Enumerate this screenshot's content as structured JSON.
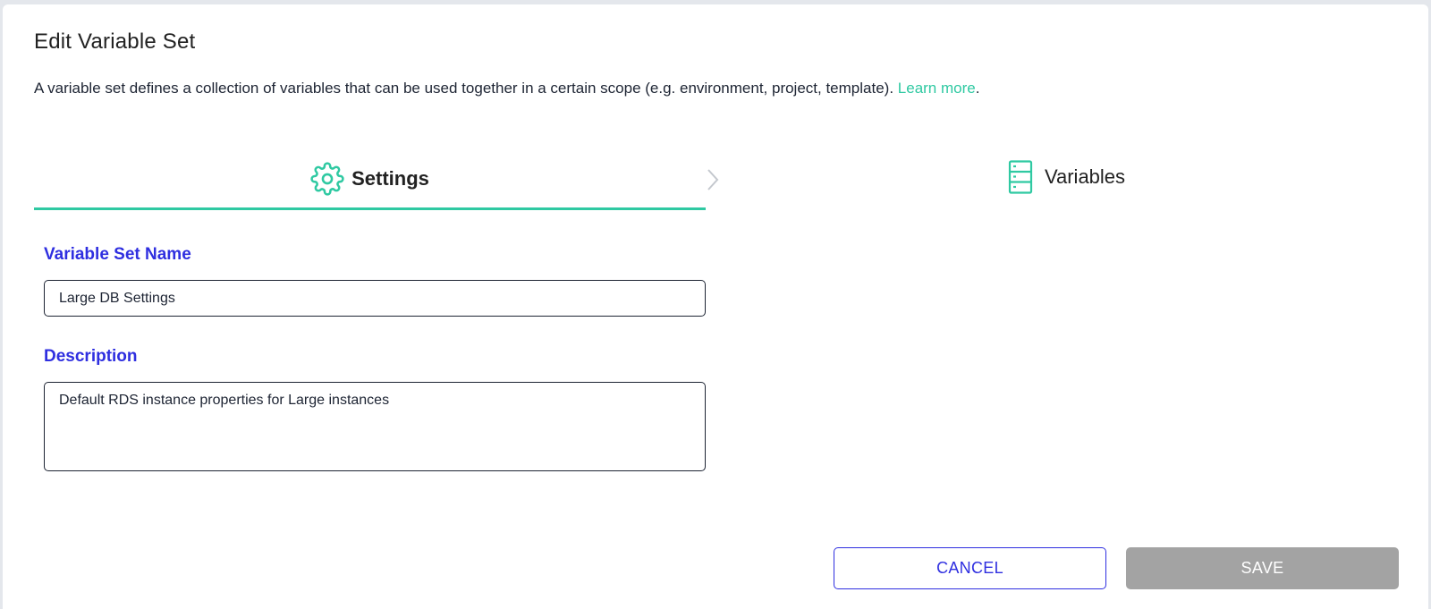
{
  "dialog": {
    "title": "Edit Variable Set",
    "description": "A variable set defines a collection of variables that can be used together in a certain scope (e.g. environment, project, template). ",
    "learn_more": "Learn more",
    "description_end": "."
  },
  "steps": [
    {
      "label": "Settings",
      "icon": "gear-icon",
      "active": true
    },
    {
      "label": "Variables",
      "icon": "server-icon",
      "active": false
    }
  ],
  "form": {
    "name_label": "Variable Set Name",
    "name_value": "Large DB Settings",
    "description_label": "Description",
    "description_value": "Default RDS instance properties for Large instances"
  },
  "buttons": {
    "cancel": "CANCEL",
    "save": "SAVE"
  },
  "colors": {
    "accent": "#2fc9a2",
    "primary": "#2f2fe0",
    "disabled": "#a3a3a3"
  }
}
